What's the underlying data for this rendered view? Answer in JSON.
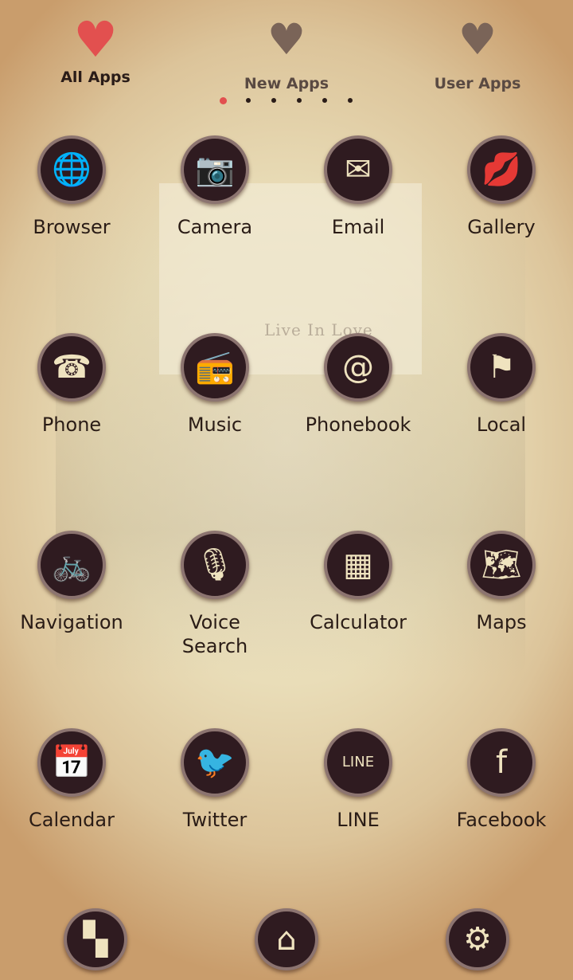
{
  "wallpaper": {
    "text": "Live In Love"
  },
  "tabs": [
    {
      "label": "All Apps",
      "active": true,
      "color": "#e2504f"
    },
    {
      "label": "New Apps",
      "active": false,
      "color": "#7a6458"
    },
    {
      "label": "User Apps",
      "active": false,
      "color": "#7a6458"
    }
  ],
  "page_indicator": {
    "count": 6,
    "current": 1
  },
  "apps": [
    {
      "label": "Browser",
      "icon": "globe-icon",
      "glyph": "🌐"
    },
    {
      "label": "Camera",
      "icon": "camera-icon",
      "glyph": "📷"
    },
    {
      "label": "Email",
      "icon": "envelope-icon",
      "glyph": "✉"
    },
    {
      "label": "Gallery",
      "icon": "photo-kiss-icon",
      "glyph": "💋"
    },
    {
      "label": "Phone",
      "icon": "telephone-icon",
      "glyph": "☎"
    },
    {
      "label": "Music",
      "icon": "radio-icon",
      "glyph": "📻"
    },
    {
      "label": "Phonebook",
      "icon": "address-book-icon",
      "glyph": "@"
    },
    {
      "label": "Local",
      "icon": "flag-icon",
      "glyph": "⚑"
    },
    {
      "label": "Navigation",
      "icon": "bicycle-icon",
      "glyph": "🚲"
    },
    {
      "label": "Voice Search",
      "icon": "microphone-icon",
      "glyph": "🎙"
    },
    {
      "label": "Calculator",
      "icon": "calculator-icon",
      "glyph": "▦"
    },
    {
      "label": "Maps",
      "icon": "map-icon",
      "glyph": "🗺"
    },
    {
      "label": "Calendar",
      "icon": "calendar-icon",
      "glyph": "📅"
    },
    {
      "label": "Twitter",
      "icon": "bird-icon",
      "glyph": "🐦"
    },
    {
      "label": "LINE",
      "icon": "line-badge-icon",
      "glyph": "LINE"
    },
    {
      "label": "Facebook",
      "icon": "facebook-badge-icon",
      "glyph": "f"
    }
  ],
  "dock": [
    {
      "icon": "app-drawer-icon",
      "glyph": "▚"
    },
    {
      "icon": "home-icon",
      "glyph": "⌂"
    },
    {
      "icon": "settings-gear-icon",
      "glyph": "⚙"
    }
  ]
}
